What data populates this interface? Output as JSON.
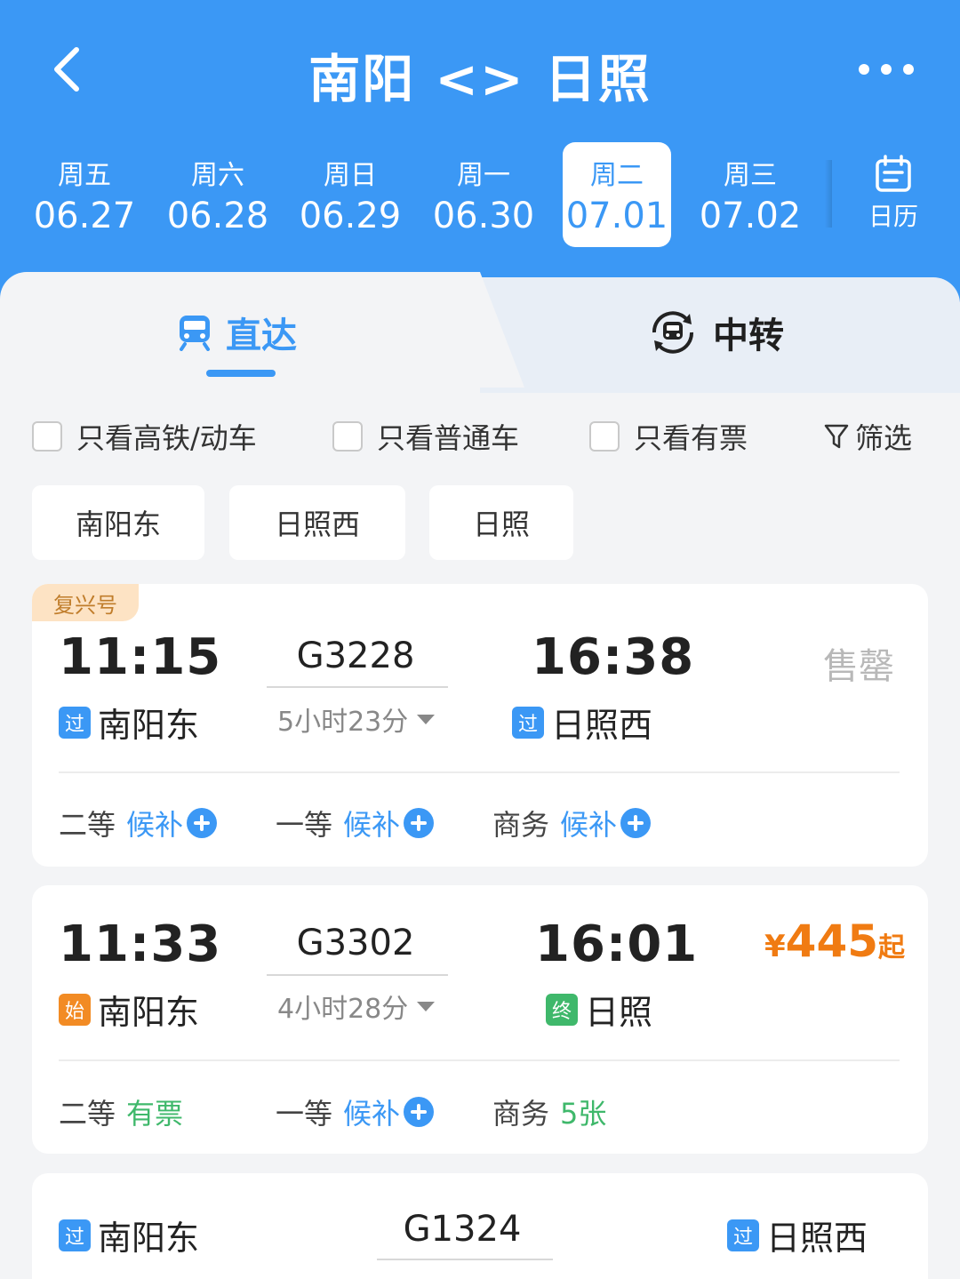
{
  "header": {
    "title": "南阳 <> 日照",
    "back_icon": "chevron-left-icon",
    "more_icon": "more-dots-icon"
  },
  "dates": [
    {
      "weekday": "周五",
      "date": "06.27",
      "active": false
    },
    {
      "weekday": "周六",
      "date": "06.28",
      "active": false
    },
    {
      "weekday": "周日",
      "date": "06.29",
      "active": false
    },
    {
      "weekday": "周一",
      "date": "06.30",
      "active": false
    },
    {
      "weekday": "周二",
      "date": "07.01",
      "active": true
    },
    {
      "weekday": "周三",
      "date": "07.02",
      "active": false
    }
  ],
  "calendar": {
    "label": "日历",
    "icon": "calendar-icon"
  },
  "tabs": {
    "direct": "直达",
    "transfer": "中转"
  },
  "filters": {
    "high_speed": "只看高铁/动车",
    "normal": "只看普通车",
    "available": "只看有票",
    "filter_button": "筛选"
  },
  "stations": [
    "南阳东",
    "日照西",
    "日照"
  ],
  "trains": [
    {
      "badge": "复兴号",
      "dep_time": "11:15",
      "arr_time": "16:38",
      "train_no": "G3228",
      "duration": "5小时23分",
      "dep_tag": "过",
      "dep_station": "南阳东",
      "arr_tag": "过",
      "arr_station": "日照西",
      "status": "售罄",
      "seats": [
        {
          "class": "二等",
          "status": "候补"
        },
        {
          "class": "一等",
          "status": "候补"
        },
        {
          "class": "商务",
          "status": "候补"
        }
      ]
    },
    {
      "dep_time": "11:33",
      "arr_time": "16:01",
      "train_no": "G3302",
      "duration": "4小时28分",
      "dep_tag": "始",
      "dep_station": "南阳东",
      "arr_tag": "终",
      "arr_station": "日照",
      "price_symbol": "¥",
      "price": "445",
      "price_suffix": "起",
      "seats": [
        {
          "class": "二等",
          "status": "有票"
        },
        {
          "class": "一等",
          "status": "候补"
        },
        {
          "class": "商务",
          "status": "5张"
        }
      ]
    },
    {
      "train_no": "G1324",
      "dep_tag": "过",
      "dep_station": "南阳东",
      "arr_tag": "过",
      "arr_station": "日照西"
    }
  ],
  "colors": {
    "primary": "#3b98f5",
    "price": "#f07b12",
    "available": "#3fb86b",
    "badge_bg": "#fde3c4"
  }
}
